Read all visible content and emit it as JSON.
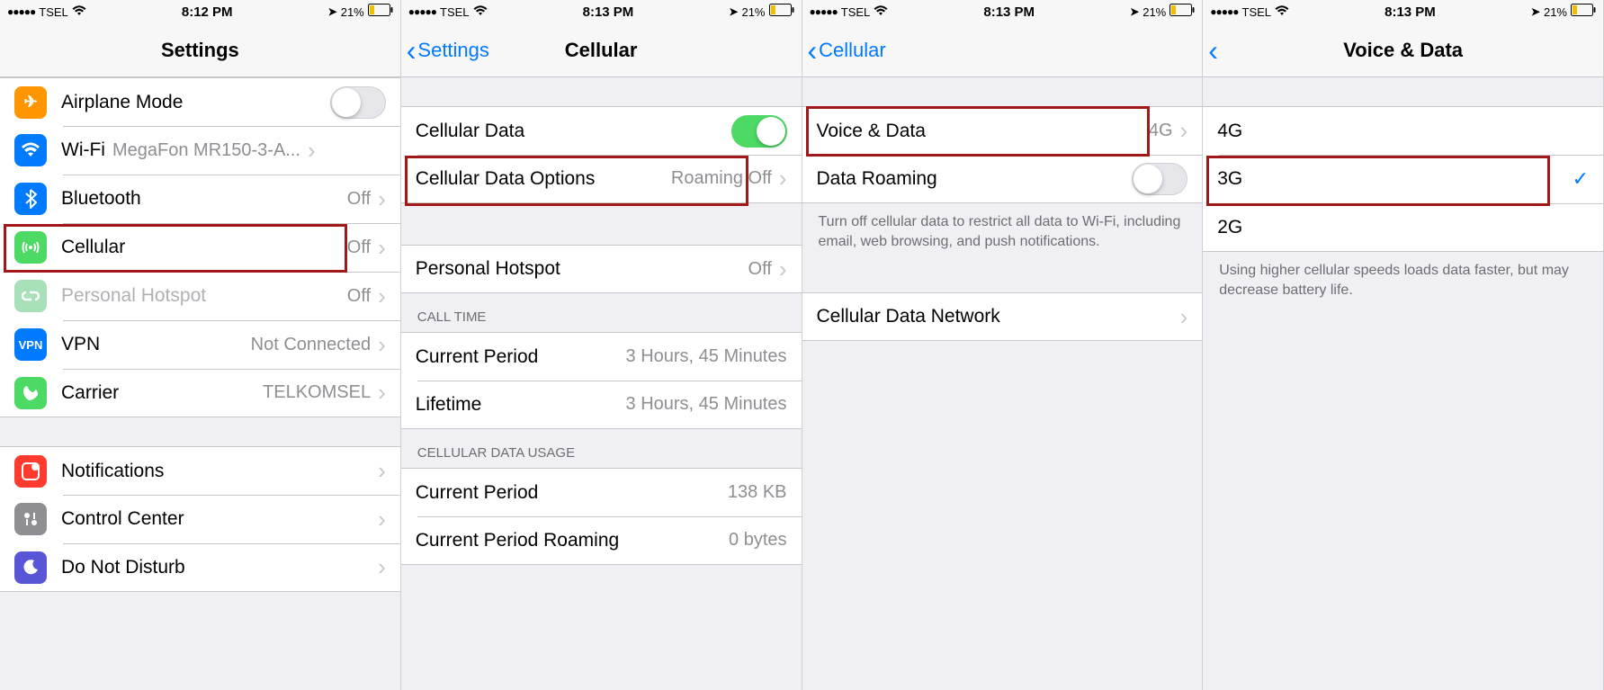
{
  "status": {
    "carrier": "TSEL",
    "time1": "8:12 PM",
    "time2": "8:13 PM",
    "battery_pct": "21%"
  },
  "screen1": {
    "title": "Settings",
    "rows": {
      "airplane": "Airplane Mode",
      "wifi": "Wi-Fi",
      "wifi_val": "MegaFon MR150-3-A...",
      "bt": "Bluetooth",
      "bt_val": "Off",
      "cellular": "Cellular",
      "cellular_val": "Off",
      "hotspot": "Personal Hotspot",
      "hotspot_val": "Off",
      "vpn": "VPN",
      "vpn_val": "Not Connected",
      "carrier": "Carrier",
      "carrier_val": "TELKOMSEL",
      "notif": "Notifications",
      "control": "Control Center",
      "dnd": "Do Not Disturb"
    }
  },
  "screen2": {
    "back": "Settings",
    "title": "Cellular",
    "rows": {
      "data": "Cellular Data",
      "options": "Cellular Data Options",
      "options_val": "Roaming Off",
      "hotspot": "Personal Hotspot",
      "hotspot_val": "Off",
      "hdr_calltime": "CALL TIME",
      "current_period": "Current Period",
      "current_period_val": "3 Hours, 45 Minutes",
      "lifetime": "Lifetime",
      "lifetime_val": "3 Hours, 45 Minutes",
      "hdr_usage": "CELLULAR DATA USAGE",
      "usage_current": "Current Period",
      "usage_current_val": "138 KB",
      "usage_roaming": "Current Period Roaming",
      "usage_roaming_val": "0 bytes"
    }
  },
  "screen3": {
    "back": "Cellular",
    "rows": {
      "voice_data": "Voice & Data",
      "voice_data_val": "4G",
      "roaming": "Data Roaming",
      "note": "Turn off cellular data to restrict all data to Wi-Fi, including email, web browsing, and push notifications.",
      "network": "Cellular Data Network"
    }
  },
  "screen4": {
    "title": "Voice & Data",
    "opts": {
      "g4": "4G",
      "g3": "3G",
      "g2": "2G"
    },
    "note": "Using higher cellular speeds loads data faster, but may decrease battery life."
  }
}
